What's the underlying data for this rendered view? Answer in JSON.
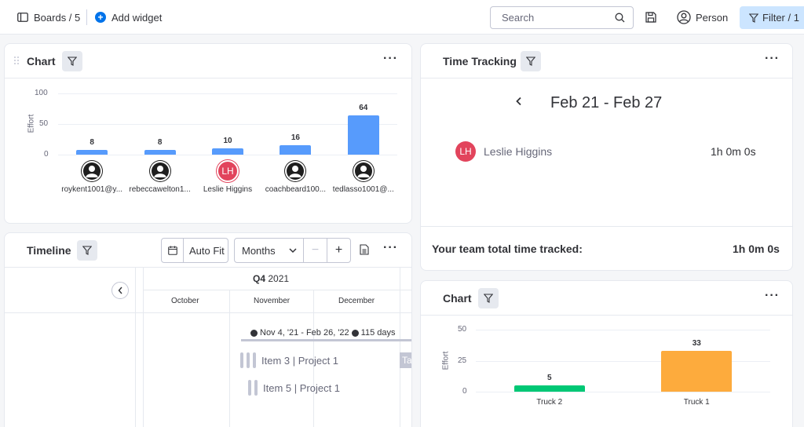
{
  "topbar": {
    "boards_label": "Boards / 5",
    "add_widget_label": "Add widget",
    "search_placeholder": "Search",
    "person_label": "Person",
    "filter_label": "Filter / 1"
  },
  "chart1": {
    "title": "Chart",
    "chart_data": {
      "type": "bar",
      "ylabel": "Effort",
      "yticks": [
        "100",
        "50",
        "0"
      ],
      "ylim": [
        0,
        100
      ],
      "color": "#579bfc",
      "categories": [
        "roykent1001@y...",
        "rebeccawelton1...",
        "Leslie Higgins",
        "coachbeard100...",
        "tedlasso1001@..."
      ],
      "values": [
        8,
        8,
        10,
        16,
        64
      ],
      "value_labels": [
        "8",
        "8",
        "10",
        "16",
        "64"
      ],
      "avatars": [
        "user-icon",
        "user-icon",
        "LH",
        "user-icon",
        "user-icon"
      ]
    }
  },
  "time_tracking": {
    "title": "Time Tracking",
    "date_range": "Feb 21 - Feb 27",
    "row": {
      "initials": "LH",
      "name": "Leslie Higgins",
      "time": "1h 0m 0s"
    },
    "total_label": "Your team total time tracked:",
    "total_value": "1h 0m 0s"
  },
  "timeline": {
    "title": "Timeline",
    "auto_fit_label": "Auto Fit",
    "scale_label": "Months",
    "quarter_label": "Q4",
    "quarter_year": "2021",
    "months": [
      "October",
      "November",
      "December"
    ],
    "group_summary": {
      "range": "Nov 4, '21 - Feb 26, '22",
      "days": "115 days"
    },
    "items": [
      "Item 3 | Project 1",
      "Item 5 | Project 1"
    ],
    "cut_off_label": "Ta"
  },
  "chart2": {
    "title": "Chart",
    "chart_data": {
      "type": "bar",
      "ylabel": "Effort",
      "yticks": [
        "50",
        "25",
        "0"
      ],
      "ylim": [
        0,
        50
      ],
      "categories": [
        "Truck 2",
        "Truck 1"
      ],
      "values": [
        5,
        33
      ],
      "value_labels": [
        "5",
        "33"
      ],
      "colors": [
        "#00c875",
        "#fdab3d"
      ]
    }
  }
}
